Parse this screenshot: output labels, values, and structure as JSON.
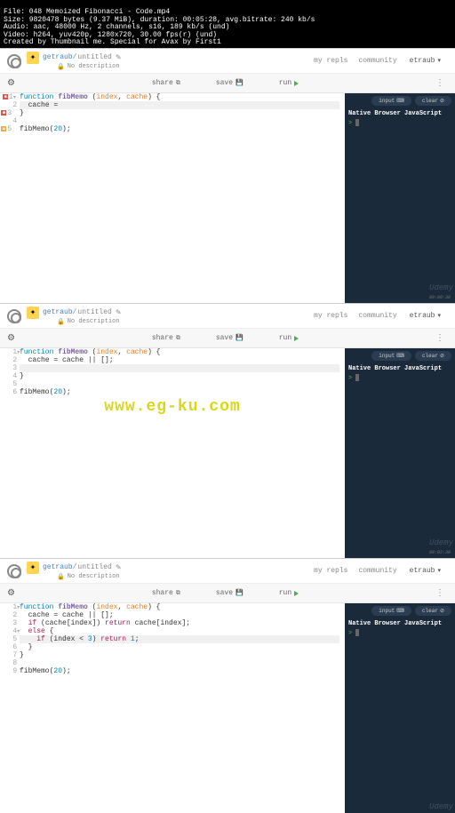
{
  "ffprobe": {
    "file": "File: 048 Memoized Fibonacci - Code.mp4",
    "size": "Size: 9820478 bytes (9.37 MiB), duration: 00:05:28, avg.bitrate: 240 kb/s",
    "audio": "Audio: aac, 48000 Hz, 2 channels, s16, 189 kb/s (und)",
    "video": "Video: h264, yuv420p, 1280x720, 30.00 fps(r) (und)",
    "created": "Created by Thumbnail me. Special for Avax by First1"
  },
  "header": {
    "user": "getraub",
    "title": "untitled",
    "no_desc": "No description",
    "my_repls": "my repls",
    "community": "community",
    "account": "etraub"
  },
  "toolbar": {
    "share": "share",
    "save": "save",
    "run": "run"
  },
  "console": {
    "input": "input",
    "clear": "clear",
    "title": "Native Browser JavaScript",
    "prompt": ">"
  },
  "watermark": "www.eg-ku.com",
  "udemy": "Udemy",
  "timestamps": {
    "t1": "00:00:30",
    "t2": "00:02:30"
  },
  "code1": {
    "l1a": "function ",
    "l1b": "fibMemo",
    "l1c": " (",
    "l1d": "index",
    "l1e": ", ",
    "l1f": "cache",
    "l1g": ") {",
    "l2": "  cache = ",
    "l3": "}",
    "l5a": "fibMemo(",
    "l5b": "20",
    "l5c": ");"
  },
  "code2": {
    "l1a": "function ",
    "l1b": "fibMemo",
    "l1c": " (",
    "l1d": "index",
    "l1e": ", ",
    "l1f": "cache",
    "l1g": ") {",
    "l2": "  cache = cache || [];",
    "l4": "}",
    "l6a": "fibMemo(",
    "l6b": "20",
    "l6c": ");"
  },
  "code3": {
    "l1a": "function ",
    "l1b": "fibMemo",
    "l1c": " (",
    "l1d": "index",
    "l1e": ", ",
    "l1f": "cache",
    "l1g": ") {",
    "l2": "  cache = cache || [];",
    "l3a": "  ",
    "l3b": "if",
    "l3c": " (cache[index]) ",
    "l3d": "return",
    "l3e": " cache[index];",
    "l4a": "  ",
    "l4b": "else",
    "l4c": " {",
    "l5a": "    ",
    "l5b": "if",
    "l5c": " (index < ",
    "l5d": "3",
    "l5e": ") ",
    "l5f": "return",
    "l5g": " ",
    "l5h": "1",
    "l5i": ";",
    "l6": "  }",
    "l7": "}",
    "l9a": "fibMemo(",
    "l9b": "20",
    "l9c": ");"
  },
  "gutters": {
    "g1": {
      "n1": "1",
      "n2": "2",
      "n3": "3",
      "n4": "4",
      "n5": "5"
    },
    "g2": {
      "n1": "1",
      "n2": "2",
      "n3": "3",
      "n4": "4",
      "n5": "5",
      "n6": "6"
    },
    "g3": {
      "n1": "1",
      "n2": "2",
      "n3": "3",
      "n4": "4",
      "n5": "5",
      "n6": "6",
      "n7": "7",
      "n8": "8",
      "n9": "9"
    }
  }
}
